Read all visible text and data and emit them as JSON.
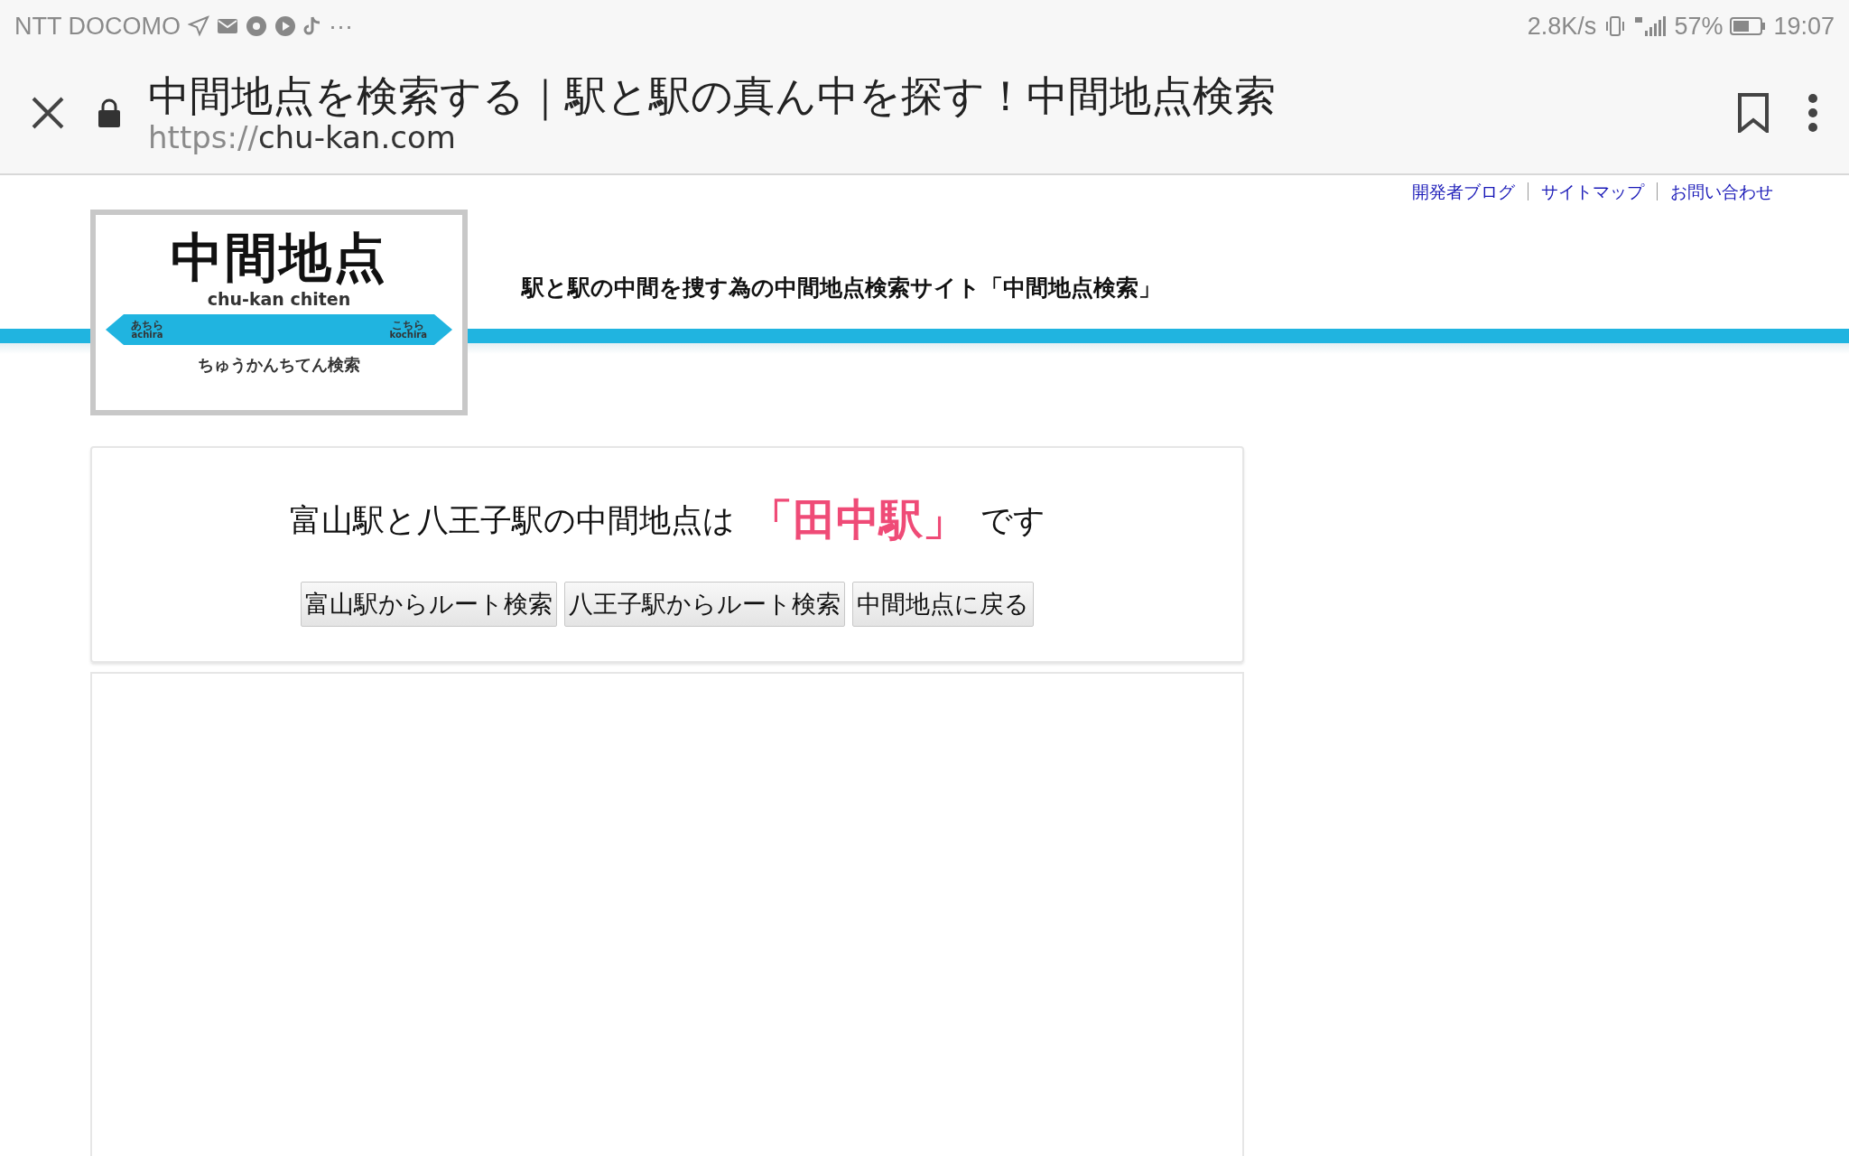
{
  "status_bar": {
    "carrier": "NTT DOCOMO",
    "more": "···",
    "speed": "2.8K/s",
    "battery": "57%",
    "time": "19:07"
  },
  "toolbar": {
    "title": "中間地点を検索する｜駅と駅の真ん中を探す！中間地点検索",
    "url_scheme": "https://",
    "url_host": "chu-kan.com"
  },
  "header_links": [
    "開発者ブログ",
    "サイトマップ",
    "お問い合わせ"
  ],
  "logo": {
    "title": "中間地点",
    "romaji": "chu-kan chiten",
    "left": "あちら",
    "left_romaji": "achira",
    "right": "こちら",
    "right_romaji": "kochira",
    "reading": "ちゅうかんちてん検索"
  },
  "tagline": "駅と駅の中間を捜す為の中間地点検索サイト「中間地点検索」",
  "result": {
    "prefix": "富山駅と八王子駅の中間地点は",
    "station": "「田中駅」",
    "suffix": "です"
  },
  "buttons": [
    "富山駅からルート検索",
    "八王子駅からルート検索",
    "中間地点に戻る"
  ]
}
